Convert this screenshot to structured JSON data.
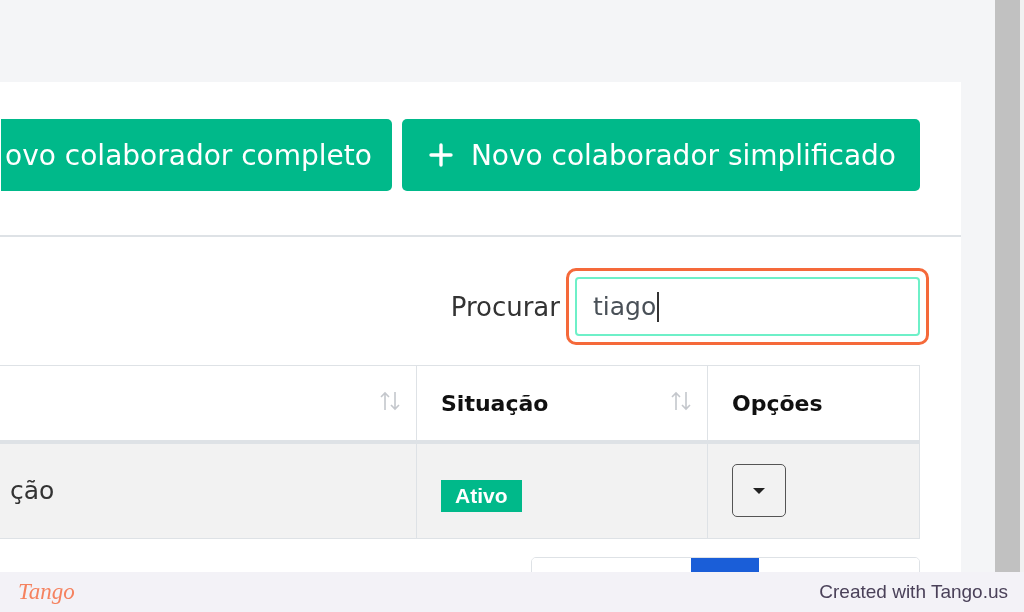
{
  "actions": [
    {
      "label": "ovo colaborador completo",
      "icon": false
    },
    {
      "label": "Novo colaborador simplificado",
      "icon": true
    }
  ],
  "search": {
    "label": "Procurar",
    "value": "tiago",
    "focused": true,
    "highlighted": true
  },
  "table": {
    "columns": [
      {
        "sortable": true
      },
      {
        "label": "Situação",
        "sortable": true
      },
      {
        "label": "Opções",
        "sortable": false
      }
    ],
    "rows": [
      {
        "shaded": true,
        "cells": [
          {
            "kind": "text",
            "text": "ção"
          },
          {
            "kind": "badge",
            "text": "Ativo"
          },
          {
            "kind": "menu"
          }
        ]
      }
    ]
  },
  "pagination": {
    "pages": [
      {
        "selected": false
      },
      {
        "selected": true
      },
      {
        "selected": false
      }
    ]
  },
  "footer": {
    "logo": "Tango",
    "credit": "Created with Tango.us"
  }
}
